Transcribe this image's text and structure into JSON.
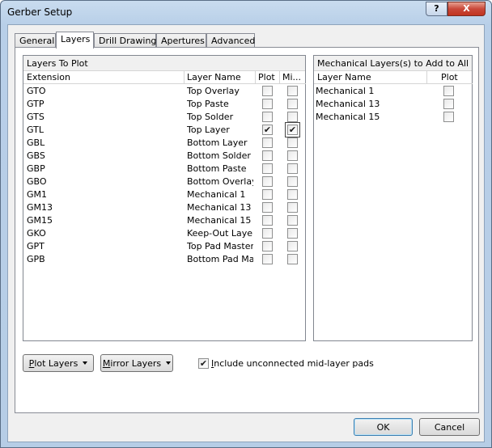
{
  "window": {
    "title": "Gerber Setup",
    "help_glyph": "?",
    "close_glyph": "X"
  },
  "tabs": [
    {
      "label": "General"
    },
    {
      "label": "Layers"
    },
    {
      "label": "Drill Drawing"
    },
    {
      "label": "Apertures"
    },
    {
      "label": "Advanced"
    }
  ],
  "active_tab": "Layers",
  "layers_to_plot": {
    "header": "Layers To Plot",
    "columns": {
      "extension": "Extension",
      "layer_name": "Layer Name",
      "plot": "Plot",
      "mirror": "Mi..."
    },
    "rows": [
      {
        "ext": "GTO",
        "name": "Top Overlay",
        "plot": "",
        "mirror": ""
      },
      {
        "ext": "GTP",
        "name": "Top Paste",
        "plot": "",
        "mirror": ""
      },
      {
        "ext": "GTS",
        "name": "Top Solder",
        "plot": "",
        "mirror": ""
      },
      {
        "ext": "GTL",
        "name": "Top Layer",
        "plot": "✔",
        "mirror": "✔"
      },
      {
        "ext": "GBL",
        "name": "Bottom Layer",
        "plot": "",
        "mirror": ""
      },
      {
        "ext": "GBS",
        "name": "Bottom Solder",
        "plot": "",
        "mirror": ""
      },
      {
        "ext": "GBP",
        "name": "Bottom Paste",
        "plot": "",
        "mirror": ""
      },
      {
        "ext": "GBO",
        "name": "Bottom Overlay",
        "plot": "",
        "mirror": ""
      },
      {
        "ext": "GM1",
        "name": "Mechanical 1",
        "plot": "",
        "mirror": ""
      },
      {
        "ext": "GM13",
        "name": "Mechanical 13",
        "plot": "",
        "mirror": ""
      },
      {
        "ext": "GM15",
        "name": "Mechanical 15",
        "plot": "",
        "mirror": ""
      },
      {
        "ext": "GKO",
        "name": "Keep-Out Layer",
        "plot": "",
        "mirror": ""
      },
      {
        "ext": "GPT",
        "name": "Top Pad Master",
        "plot": "",
        "mirror": ""
      },
      {
        "ext": "GPB",
        "name": "Bottom Pad Mas",
        "plot": "",
        "mirror": ""
      }
    ]
  },
  "mechanical_layers": {
    "header": "Mechanical Layers(s) to Add to All P...",
    "columns": {
      "layer_name": "Layer Name",
      "plot": "Plot"
    },
    "rows": [
      {
        "name": "Mechanical 1",
        "plot": ""
      },
      {
        "name": "Mechanical 13",
        "plot": ""
      },
      {
        "name": "Mechanical 15",
        "plot": ""
      }
    ]
  },
  "bottom": {
    "plot_layers": {
      "underline": "P",
      "rest": "lot Layers"
    },
    "mirror_layers": {
      "underline": "M",
      "rest": "irror Layers"
    },
    "include_unconnected": {
      "checked": "✔",
      "underline": "I",
      "rest": "nclude unconnected mid-layer pads"
    }
  },
  "footer": {
    "ok": "OK",
    "cancel": "Cancel"
  }
}
